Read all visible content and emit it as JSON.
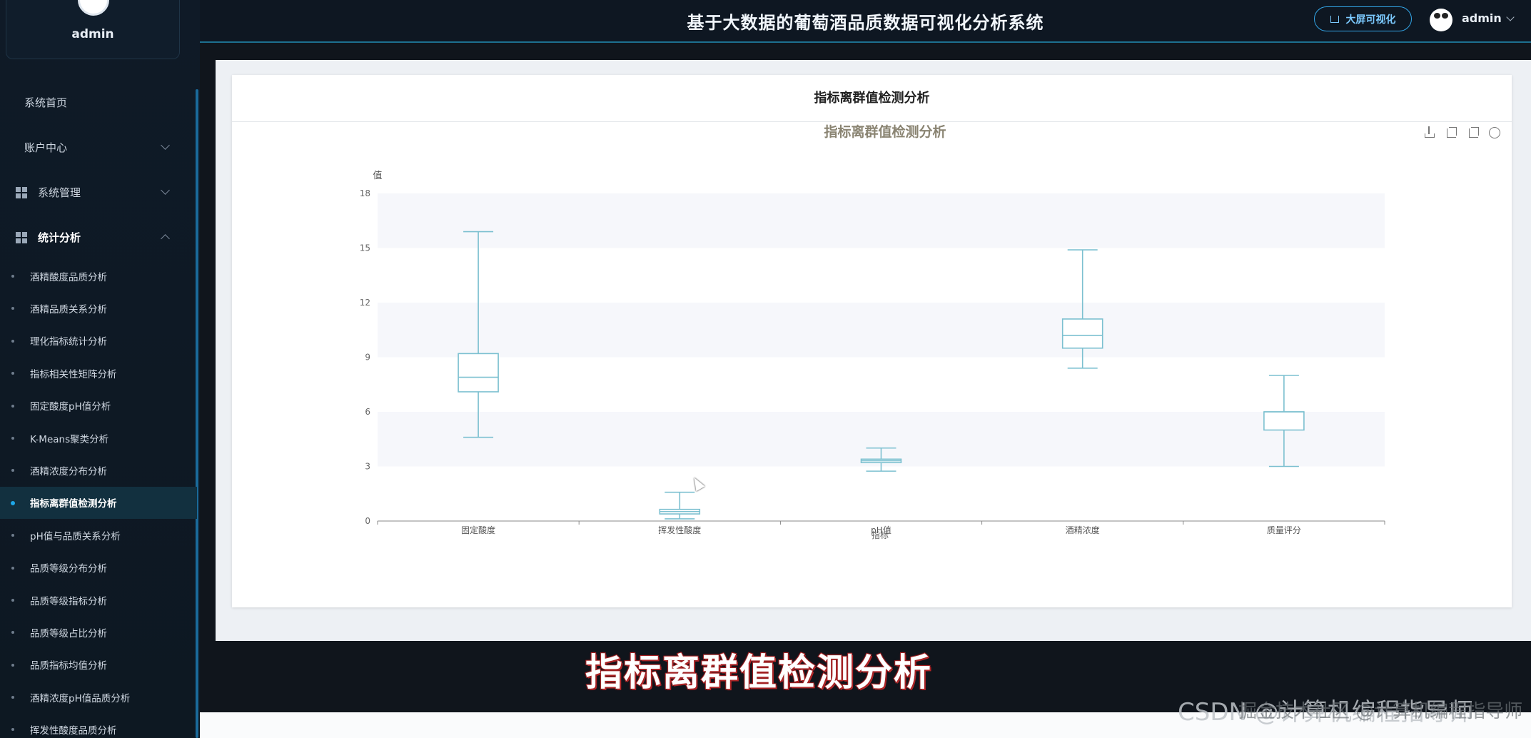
{
  "sidebar": {
    "username": "admin",
    "menu": [
      {
        "label": "系统首页"
      },
      {
        "label": "账户中心"
      },
      {
        "label": "系统管理"
      },
      {
        "label": "统计分析"
      }
    ],
    "stats_items": [
      {
        "label": "酒精酸度品质分析"
      },
      {
        "label": "酒精品质关系分析"
      },
      {
        "label": "理化指标统计分析"
      },
      {
        "label": "指标相关性矩阵分析"
      },
      {
        "label": "固定酸度pH值分析"
      },
      {
        "label": "K-Means聚类分析"
      },
      {
        "label": "酒精浓度分布分析"
      },
      {
        "label": "指标离群值检测分析"
      },
      {
        "label": "pH值与品质关系分析"
      },
      {
        "label": "品质等级分布分析"
      },
      {
        "label": "品质等级指标分析"
      },
      {
        "label": "品质等级占比分析"
      },
      {
        "label": "品质指标均值分析"
      },
      {
        "label": "酒精浓度pH值品质分析"
      },
      {
        "label": "挥发性酸度品质分析"
      }
    ]
  },
  "header": {
    "title": "基于大数据的葡萄酒品质数据可视化分析系统",
    "screen_button": "大屏可视化",
    "username": "admin"
  },
  "card": {
    "title": "指标离群值检测分析"
  },
  "caption": "指标离群值检测分析",
  "watermark": "CSDN @计算机编程指导师",
  "watermark_overlay": "掘金技术社区 @计算机编程指导师",
  "colors": {
    "box_stroke": "#7cc0d0",
    "band": "#f6f7fb",
    "accent": "#1ea7e8"
  },
  "chart_data": {
    "type": "boxplot",
    "title": "指标离群值检测分析",
    "ylabel": "值",
    "xlabel": "指标",
    "ylim": [
      0,
      18
    ],
    "yticks": [
      0,
      3,
      6,
      9,
      12,
      15,
      18
    ],
    "categories": [
      "固定酸度",
      "挥发性酸度",
      "pH值",
      "酒精浓度",
      "质量评分"
    ],
    "series": [
      {
        "boxes": [
          {
            "min": 4.6,
            "q1": 7.1,
            "median": 7.9,
            "q3": 9.2,
            "max": 15.9
          },
          {
            "min": 0.12,
            "q1": 0.39,
            "median": 0.52,
            "q3": 0.64,
            "max": 1.58
          },
          {
            "min": 2.74,
            "q1": 3.21,
            "median": 3.31,
            "q3": 3.4,
            "max": 4.01
          },
          {
            "min": 8.4,
            "q1": 9.5,
            "median": 10.2,
            "q3": 11.1,
            "max": 14.9
          },
          {
            "min": 3,
            "q1": 5,
            "median": 6,
            "q3": 6,
            "max": 8
          }
        ]
      }
    ],
    "grid": true,
    "legend": "none"
  }
}
